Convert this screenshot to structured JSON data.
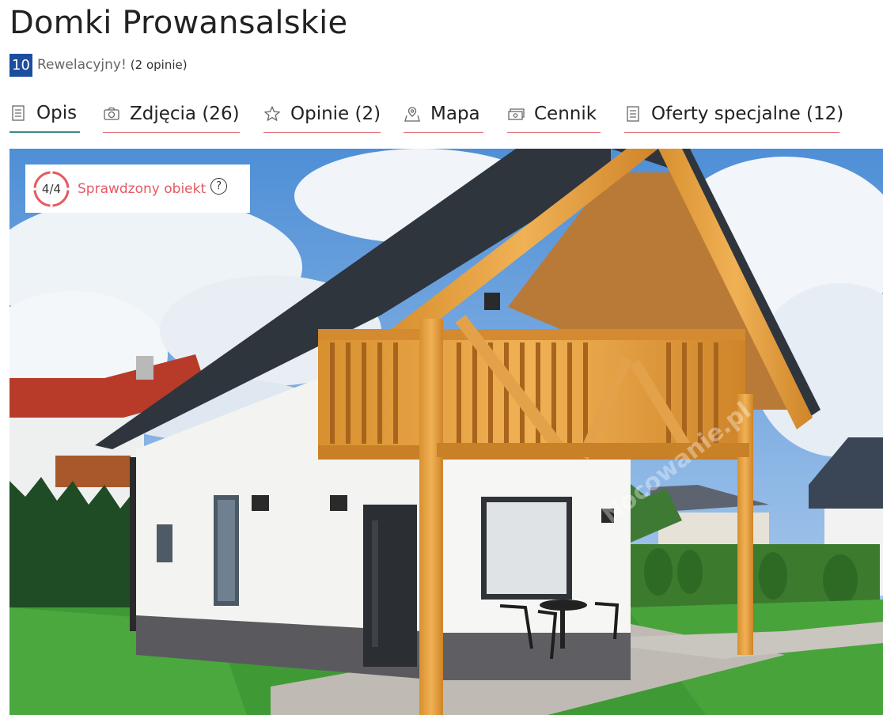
{
  "listing": {
    "title": "Domki Prowansalskie",
    "rating": {
      "score": "10",
      "label": "Rewelacyjny!",
      "reviews": "(2 opinie)"
    }
  },
  "tabs": [
    {
      "label": "Opis",
      "icon": "document-icon",
      "active": true
    },
    {
      "label": "Zdjęcia (26)",
      "icon": "camera-icon",
      "active": false
    },
    {
      "label": "Opinie (2)",
      "icon": "star-icon",
      "active": false
    },
    {
      "label": "Mapa",
      "icon": "map-pin-icon",
      "active": false
    },
    {
      "label": "Cennik",
      "icon": "money-icon",
      "active": false
    },
    {
      "label": "Oferty specjalne (12)",
      "icon": "document-icon",
      "active": false
    }
  ],
  "photo": {
    "badge": {
      "progress": "4/4",
      "label": "Sprawdzony obiekt",
      "help": "?"
    },
    "watermark": "Nocowanie.pl"
  },
  "colors": {
    "score_bg": "#1d4e9e",
    "accent_red": "#e55a61",
    "active_tab": "#3a8a88"
  }
}
